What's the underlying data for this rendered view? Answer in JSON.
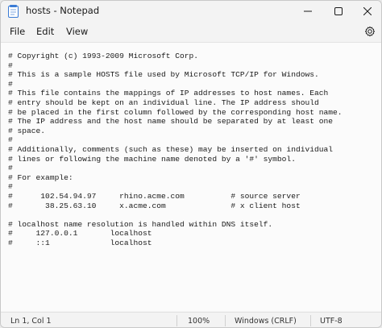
{
  "window": {
    "title": "hosts - Notepad",
    "icon": "notepad-icon",
    "controls": [
      "minimize-icon",
      "maximize-icon",
      "close-icon"
    ]
  },
  "menu": {
    "file": "File",
    "edit": "Edit",
    "view": "View",
    "settings_icon": "gear-icon"
  },
  "document": {
    "lines": [
      "# Copyright (c) 1993-2009 Microsoft Corp.",
      "#",
      "# This is a sample HOSTS file used by Microsoft TCP/IP for Windows.",
      "#",
      "# This file contains the mappings of IP addresses to host names. Each",
      "# entry should be kept on an individual line. The IP address should",
      "# be placed in the first column followed by the corresponding host name.",
      "# The IP address and the host name should be separated by at least one",
      "# space.",
      "#",
      "# Additionally, comments (such as these) may be inserted on individual",
      "# lines or following the machine name denoted by a '#' symbol.",
      "#",
      "# For example:",
      "#",
      "#      102.54.94.97     rhino.acme.com          # source server",
      "#       38.25.63.10     x.acme.com              # x client host",
      "",
      "# localhost name resolution is handled within DNS itself.",
      "#     127.0.0.1       localhost",
      "#     ::1             localhost"
    ]
  },
  "status": {
    "position": "Ln 1, Col 1",
    "zoom": "100%",
    "line_ending": "Windows (CRLF)",
    "encoding": "UTF-8"
  }
}
